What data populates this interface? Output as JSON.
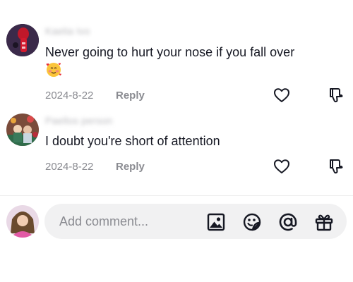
{
  "comments": [
    {
      "username": "Kaelia Ivo",
      "text": "Never going to hurt your nose if you fall over",
      "emoji": "smiling-face-with-hearts",
      "date": "2024-8-22",
      "reply_label": "Reply",
      "like_icon": "heart-outline-icon",
      "dislike_icon": "thumbs-down-icon"
    },
    {
      "username": "Paellos person",
      "text": "I doubt you're short of attention",
      "date": "2024-8-22",
      "reply_label": "Reply",
      "like_icon": "heart-outline-icon",
      "dislike_icon": "thumbs-down-icon"
    }
  ],
  "composer": {
    "placeholder": "Add comment...",
    "tools": [
      "image-icon",
      "emoji-sticker-icon",
      "mention-icon",
      "gift-icon"
    ]
  },
  "colors": {
    "text": "#161823",
    "secondary": "#8a8b91",
    "input_bg": "#f1f1f2",
    "divider": "#ededee"
  }
}
